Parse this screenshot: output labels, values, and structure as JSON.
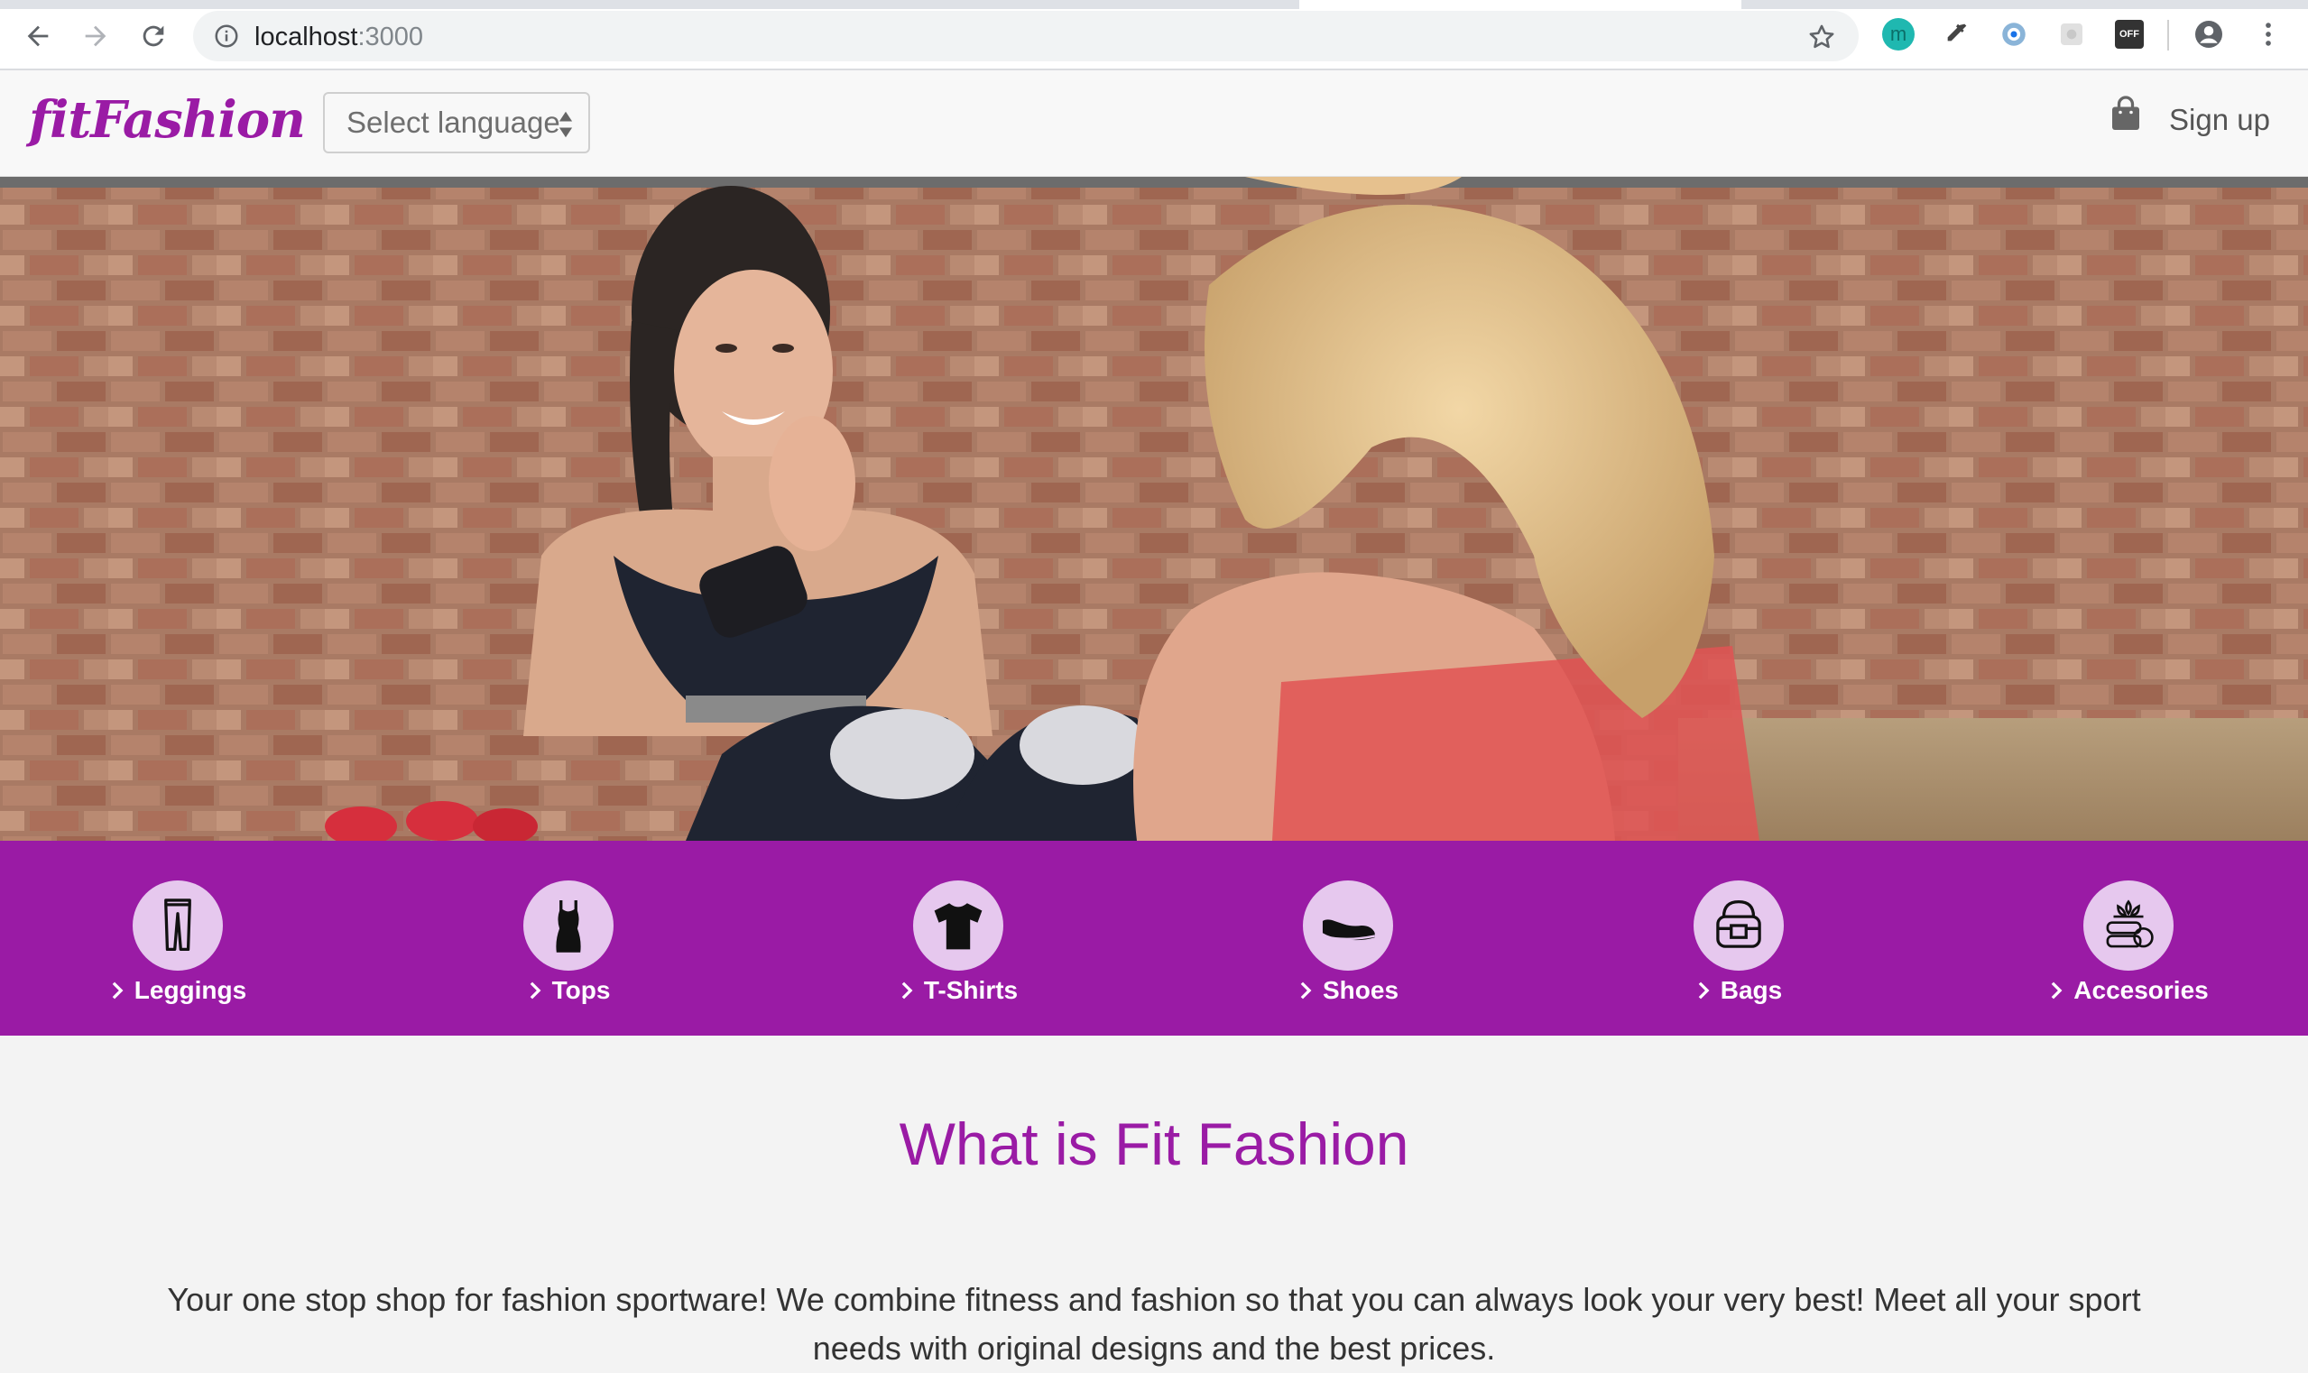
{
  "browser": {
    "url_host": "localhost",
    "url_port": ":3000",
    "extensions": [
      {
        "name": "m-extension-icon",
        "label": "m"
      },
      {
        "name": "eyedropper-extension-icon",
        "label": ""
      },
      {
        "name": "react-devtools-extension-icon",
        "label": ""
      },
      {
        "name": "gray-extension-icon",
        "label": ""
      },
      {
        "name": "off-extension-icon",
        "label": "OFF"
      }
    ]
  },
  "header": {
    "logo": "fitFashion",
    "language_select": "Select language",
    "signup": "Sign up"
  },
  "categories": [
    {
      "label": "Leggings",
      "icon": "leggings-icon"
    },
    {
      "label": "Tops",
      "icon": "tank-top-icon"
    },
    {
      "label": "T-Shirts",
      "icon": "t-shirt-icon"
    },
    {
      "label": "Shoes",
      "icon": "sneaker-icon"
    },
    {
      "label": "Bags",
      "icon": "gym-bag-icon"
    },
    {
      "label": "Accesories",
      "icon": "accessories-icon"
    }
  ],
  "about": {
    "title": "What is Fit Fashion",
    "text": "Your one stop shop for fashion sportware! We combine fitness and fashion so that you can always look your very best! Meet all your sport needs with original designs and the best prices."
  },
  "colors": {
    "brand": "#9a1ba5",
    "category_circle": "#e6c8ee",
    "page_background": "#f3f3f3"
  }
}
